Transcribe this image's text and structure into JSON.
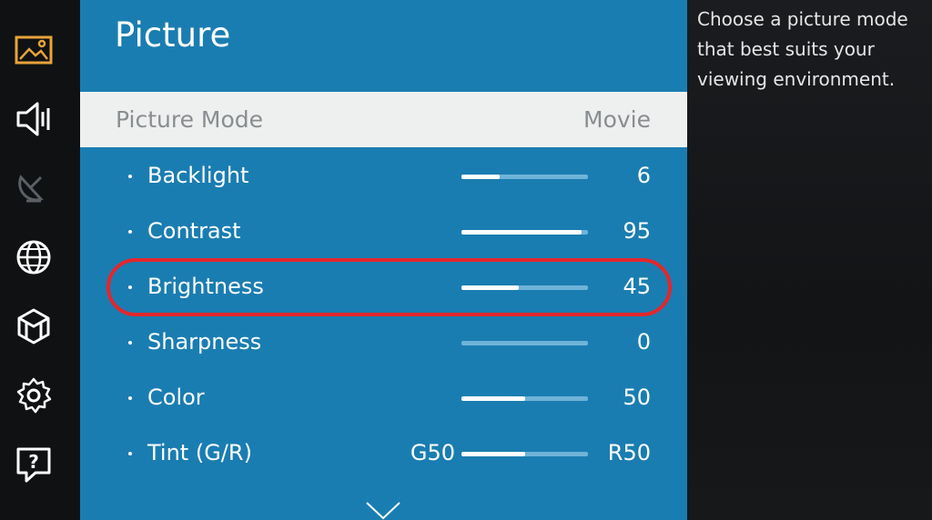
{
  "sidebar": {
    "items": [
      {
        "icon": "picture-icon",
        "active": true
      },
      {
        "icon": "sound-icon",
        "active": false
      },
      {
        "icon": "broadcast-icon",
        "active": false,
        "disabled": true
      },
      {
        "icon": "network-icon",
        "active": false
      },
      {
        "icon": "smart-hub-icon",
        "active": false
      },
      {
        "icon": "gear-icon",
        "active": false
      },
      {
        "icon": "support-icon",
        "active": false
      }
    ]
  },
  "panel": {
    "title": "Picture",
    "picture_mode": {
      "label": "Picture Mode",
      "value": "Movie"
    },
    "settings": [
      {
        "name": "Backlight",
        "value": "6",
        "level": 0.3
      },
      {
        "name": "Contrast",
        "value": "95",
        "level": 0.95
      },
      {
        "name": "Brightness",
        "value": "45",
        "level": 0.45
      },
      {
        "name": "Sharpness",
        "value": "0",
        "level": 0.0
      },
      {
        "name": "Color",
        "value": "50",
        "level": 0.5
      },
      {
        "name": "Tint (G/R)",
        "left": "G50",
        "value": "R50",
        "level": 0.5
      }
    ]
  },
  "help": {
    "text": "Choose a picture mode that best suits your viewing environment."
  },
  "colors": {
    "panel_bg": "#1a7db1",
    "highlight": "#e4262c",
    "active_icon": "#e8a33a",
    "icon": "#ffffff"
  }
}
